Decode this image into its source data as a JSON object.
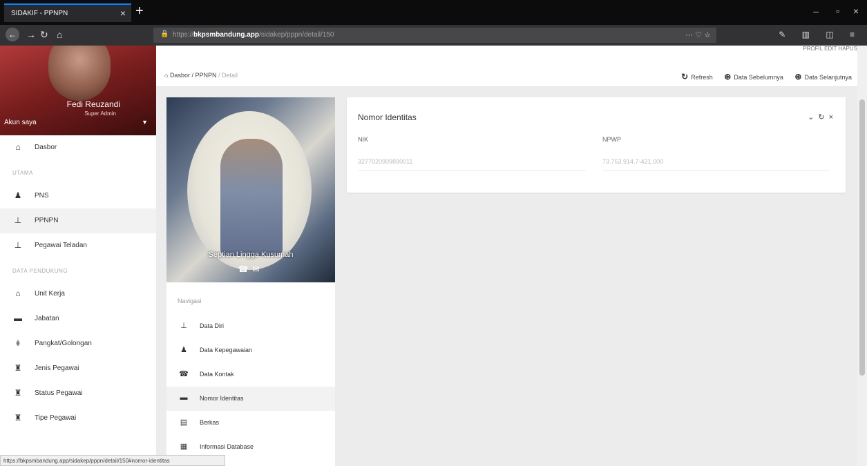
{
  "browser": {
    "tab_title": "SIDAKIF - PPNPN",
    "url_prefix": "https://",
    "url_host": "bkpsmbandung.app",
    "url_path": "/sidakep/pppn/detail/150",
    "status_url": "https://bkpsmbandung.app/sidakep/pppn/detail/150#nomor-identitas"
  },
  "sidebar": {
    "user_name": "Fedi Reuzandi",
    "user_role": "Super Admin",
    "account_label": "Akun saya",
    "items": [
      {
        "label": "Dasbor",
        "icon": "home-icon"
      },
      {
        "header": "UTAMA"
      },
      {
        "label": "PNS",
        "icon": "user-tie-icon"
      },
      {
        "label": "PPNPN",
        "icon": "user-icon",
        "active": true
      },
      {
        "label": "Pegawai Teladan",
        "icon": "user-star-icon"
      },
      {
        "header": "DATA PENDUKUNG"
      },
      {
        "label": "Unit Kerja",
        "icon": "building-icon"
      },
      {
        "label": "Jabatan",
        "icon": "id-card-icon"
      },
      {
        "label": "Pangkat/Golongan",
        "icon": "rank-icon"
      },
      {
        "label": "Jenis Pegawai",
        "icon": "users-icon"
      },
      {
        "label": "Status Pegawai",
        "icon": "users-status-icon"
      },
      {
        "label": "Tipe Pegawai",
        "icon": "users-type-icon"
      }
    ]
  },
  "header": {
    "top_links": "PROFIL     EDIT     HAPUS",
    "crumb_home": "Dasbor",
    "crumb_section": "PPNPN",
    "crumb_current": "Detail",
    "refresh": "Refresh",
    "prev": "Data Sebelumnya",
    "next": "Data Selanjutnya"
  },
  "profile_card": {
    "name": "Septian Lingga Kusumah"
  },
  "nav_card": {
    "header": "Navigasi",
    "items": [
      {
        "label": "Data Diri",
        "icon": "user-icon"
      },
      {
        "label": "Data Kepegawaian",
        "icon": "user-tie-icon"
      },
      {
        "label": "Data Kontak",
        "icon": "phone-icon"
      },
      {
        "label": "Nomor Identitas",
        "icon": "id-card-icon",
        "active": true
      },
      {
        "label": "Berkas",
        "icon": "file-icon"
      },
      {
        "label": "Informasi Database",
        "icon": "database-icon"
      }
    ]
  },
  "identity": {
    "title": "Nomor Identitas",
    "nik_label": "NIK",
    "nik_value": "3277020909890011",
    "npwp_label": "NPWP",
    "npwp_value": "73.753.914.7-421.000"
  }
}
